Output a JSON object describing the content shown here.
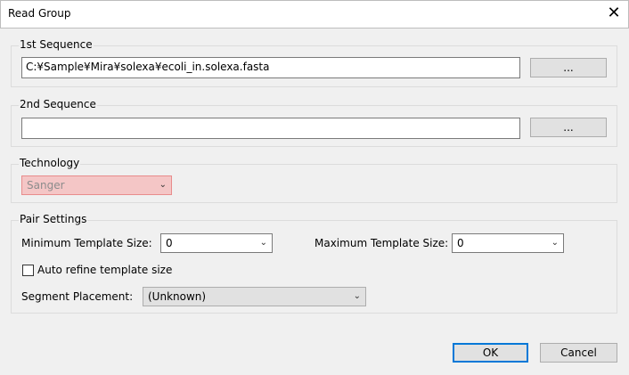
{
  "window": {
    "title": "Read Group",
    "close_symbol": "✕"
  },
  "seq1": {
    "label": "1st Sequence",
    "path": "C:¥Sample¥Mira¥solexa¥ecoli_in.solexa.fasta",
    "browse_label": "..."
  },
  "seq2": {
    "label": "2nd Sequence",
    "path": "",
    "browse_label": "..."
  },
  "technology": {
    "label": "Technology",
    "value": "Sanger"
  },
  "pair": {
    "label": "Pair Settings",
    "min_label": "Minimum Template Size:",
    "min_value": "0",
    "max_label": "Maximum Template Size:",
    "max_value": "0",
    "auto_refine_label": "Auto refine template size",
    "auto_refine_checked": false,
    "segment_label": "Segment Placement:",
    "segment_value": "(Unknown)"
  },
  "buttons": {
    "ok": "OK",
    "cancel": "Cancel"
  },
  "colors": {
    "focus_border": "#0078d7",
    "invalid_fill": "#f4c6c6"
  }
}
